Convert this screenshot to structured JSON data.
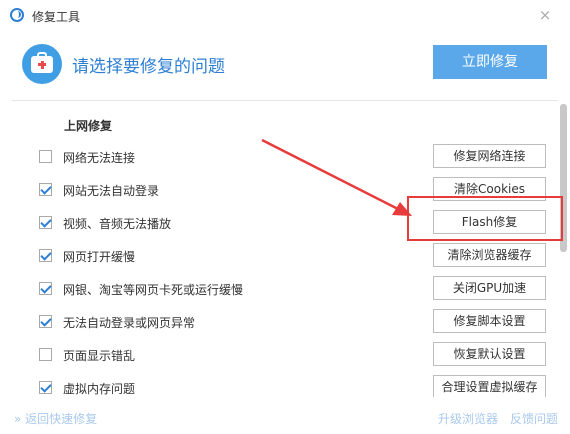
{
  "window": {
    "title": "修复工具",
    "close_glyph": "×"
  },
  "header": {
    "title": "请选择要修复的问题",
    "primary_button": "立即修复"
  },
  "section": {
    "title": "上网修复"
  },
  "rows": [
    {
      "label": "网络无法连接",
      "checked": false,
      "button": "修复网络连接"
    },
    {
      "label": "网站无法自动登录",
      "checked": true,
      "button": "清除Cookies"
    },
    {
      "label": "视频、音频无法播放",
      "checked": true,
      "button": "Flash修复"
    },
    {
      "label": "网页打开缓慢",
      "checked": true,
      "button": "清除浏览器缓存"
    },
    {
      "label": "网银、淘宝等网页卡死或运行缓慢",
      "checked": true,
      "button": "关闭GPU加速"
    },
    {
      "label": "无法自动登录或网页异常",
      "checked": true,
      "button": "修复脚本设置"
    },
    {
      "label": "页面显示错乱",
      "checked": false,
      "button": "恢复默认设置"
    },
    {
      "label": "虚拟内存问题",
      "checked": true,
      "button": "合理设置虚拟缓存"
    }
  ],
  "footer": {
    "back_link": "» 返回快速修复",
    "upgrade_link": "升级浏览器",
    "feedback_link": "反馈问题"
  },
  "colors": {
    "accent": "#2d7fd3",
    "primary_button": "#5aa8e9",
    "annotation": "#e83b3b"
  }
}
